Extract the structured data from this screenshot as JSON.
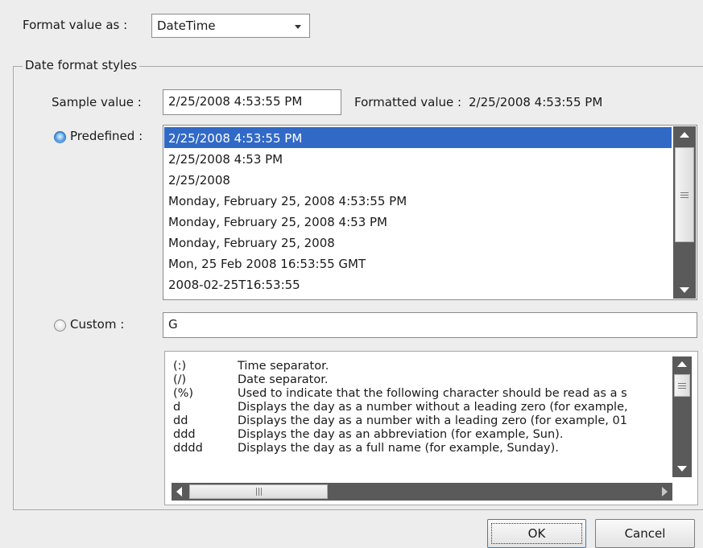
{
  "format": {
    "label": "Format value as :",
    "selected": "DateTime"
  },
  "group": {
    "title": "Date format styles",
    "sample": {
      "label": "Sample value :",
      "value": "2/25/2008 4:53:55 PM"
    },
    "formatted": {
      "label": "Formatted value :",
      "value": "2/25/2008 4:53:55 PM"
    },
    "predefined": {
      "label": "Predefined :",
      "selected": true,
      "items": [
        "2/25/2008 4:53:55 PM",
        "2/25/2008 4:53 PM",
        "2/25/2008",
        "Monday, February 25, 2008 4:53:55 PM",
        "Monday, February 25, 2008 4:53 PM",
        "Monday, February 25, 2008",
        "Mon, 25 Feb 2008 16:53:55 GMT",
        "2008-02-25T16:53:55"
      ]
    },
    "custom": {
      "label": "Custom :",
      "selected": false,
      "value": "G"
    },
    "help_rows": [
      {
        "code": "(:)",
        "desc": "Time separator."
      },
      {
        "code": "(/)",
        "desc": "Date separator."
      },
      {
        "code": "(%)",
        "desc": "Used to indicate that the following character should be read as a s"
      },
      {
        "code": "d",
        "desc": "Displays the day as a number without a leading zero (for example,"
      },
      {
        "code": "dd",
        "desc": "Displays the day as a number with a leading zero (for example, 01"
      },
      {
        "code": "ddd",
        "desc": "Displays the day as an abbreviation (for example, Sun)."
      },
      {
        "code": "dddd",
        "desc": "Displays the day as a full name (for example, Sunday)."
      }
    ]
  },
  "buttons": {
    "ok": "OK",
    "cancel": "Cancel"
  },
  "colors": {
    "selection": "#3169c6",
    "scrollbar": "#5a5a5a"
  }
}
